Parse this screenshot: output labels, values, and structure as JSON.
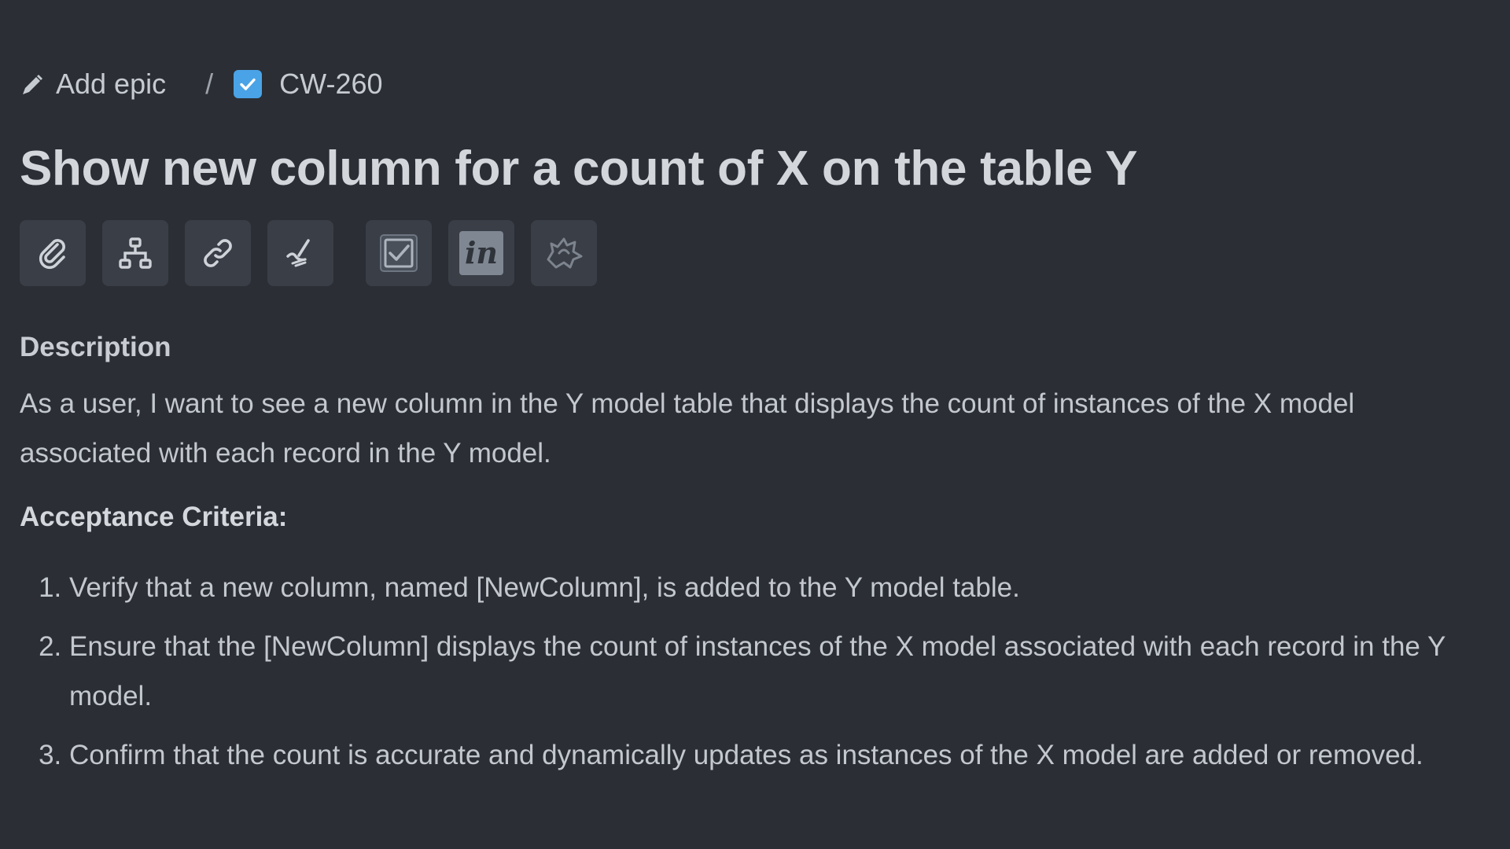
{
  "breadcrumb": {
    "epic_label": "Add epic",
    "separator": "/",
    "issue_key": "CW-260"
  },
  "issue": {
    "title": "Show new column for a count of X on the table Y"
  },
  "toolbar": {
    "buttons": [
      {
        "icon": "paperclip-icon"
      },
      {
        "icon": "hierarchy-icon"
      },
      {
        "icon": "link-icon"
      },
      {
        "icon": "sign-pen-icon"
      },
      {
        "icon": "checkbox-icon"
      },
      {
        "icon": "invision-icon",
        "label": "in"
      },
      {
        "icon": "bell-puzzle-icon"
      }
    ]
  },
  "description": {
    "heading": "Description",
    "body": "As a user, I want to see a new column in the Y model table that displays the count of instances of the X model associated with each record in the Y model.",
    "acceptance_heading": "Acceptance Criteria:",
    "criteria": [
      "Verify that a new column, named [NewColumn], is added to the Y model table.",
      "Ensure that the [NewColumn] displays the count of instances of the X model associated with each record in the Y model.",
      "Confirm that the count is accurate and dynamically updates as instances of the X model are added or removed."
    ]
  },
  "colors": {
    "background": "#2b2e35",
    "button_bg": "#3a3e46",
    "accent_blue": "#4aa3e6",
    "text": "#c3c7ce"
  }
}
